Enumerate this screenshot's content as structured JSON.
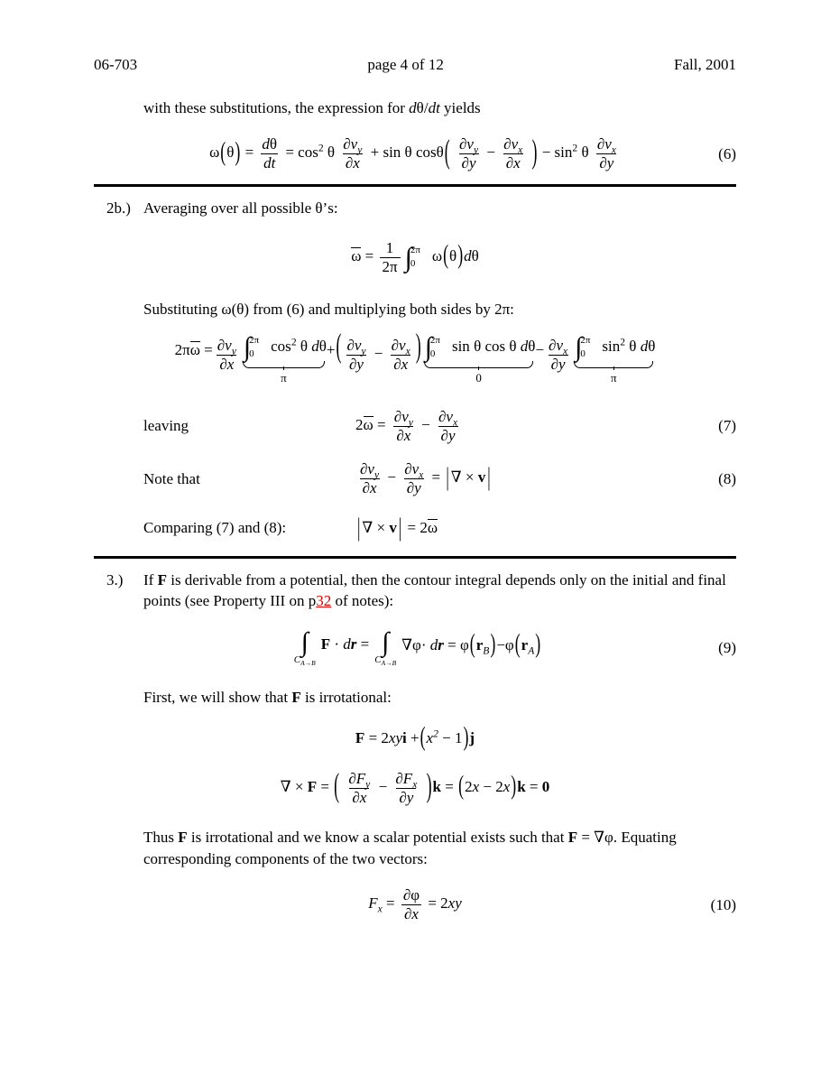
{
  "document": {
    "header": {
      "course_code": "06-703",
      "page_label": "page 4 of 12",
      "term": "Fall, 2001"
    },
    "intro_line": "with these substitutions, the expression for dθ/dt yields",
    "intro_parts": {
      "before": "with these substitutions, the expression for ",
      "math_d": "d",
      "math_theta": "θ",
      "math_slash": "/",
      "math_dt": "dt",
      "after": " yields"
    },
    "equations": {
      "eq6": {
        "number": "(6)",
        "omega": "ω",
        "theta": "θ",
        "lparen": "(",
        "rparen": ")",
        "equals": "=",
        "plus": "+",
        "minus": "−",
        "d_num": "d",
        "d_den": "dt",
        "cos": "cos",
        "sin": "sin",
        "exp2": "2",
        "partial": "∂",
        "v": "v",
        "sub_x": "x",
        "sub_y": "y"
      },
      "eq_avg": {
        "omega_bar": "ω",
        "equals": "=",
        "one": "1",
        "two_pi": "2π",
        "upper": "2π",
        "lower": "0",
        "integrand": "ω(θ)dθ"
      },
      "eq_big": {
        "lhs": "2πω",
        "equals": "=",
        "plus": "+",
        "minus": "−",
        "upper": "2π",
        "lower": "0",
        "term1_body": "cos² θ dθ",
        "term1_value": "π",
        "term2_body": "sin θ cos θ dθ",
        "term2_value": "0",
        "term3_body": "sin² θ dθ",
        "term3_value": "π"
      },
      "eq7": {
        "number": "(7)",
        "label": "leaving",
        "lhs": "2ω"
      },
      "eq8": {
        "number": "(8)",
        "label": "Note that",
        "rhs": "|∇ × v|"
      },
      "eq_compare": {
        "label": "Comparing (7) and (8):",
        "body": "|∇ × v| = 2ω"
      },
      "eq9": {
        "number": "(9)",
        "contour": "C",
        "contour_sub": "A→B",
        "F": "F",
        "dr": "dr",
        "nabla": "∇",
        "phi": "φ",
        "equals": "=",
        "minus": "−",
        "r": "r",
        "sub_B": "B",
        "sub_A": "A"
      },
      "eq_F": {
        "body": "F = 2xyi + (x² − 1)j"
      },
      "eq_curl": {
        "body": "∇ × F = (∂F_y/∂x − ∂F_x/∂y)k = (2x − 2x)k = 0"
      },
      "eq10": {
        "number": "(10)",
        "F": "F",
        "sub_x": "x",
        "equals": "=",
        "partial": "∂",
        "phi": "φ",
        "den": "∂x",
        "rhs": "2xy"
      }
    },
    "sections": [
      {
        "number": "2b.)",
        "text": "Averaging over all possible θ’s:"
      },
      {
        "number": "3.)",
        "text_part1": "If ",
        "bold_F": "F",
        "text_part2": " is derivable from a potential, then the contour integral depends only on the initial and final points (see Property III on p",
        "link_text": "32",
        "text_part3": " of notes):"
      }
    ],
    "paragraphs": {
      "substituting": "Substituting ω(θ) from (6) and multiplying both sides by 2π:",
      "first_show": "First, we will show that F is irrotational:",
      "first_show_a": "First, we will show that ",
      "first_show_b": "F",
      "first_show_c": " is irrotational:",
      "thus_a": "Thus ",
      "thus_b": "F",
      "thus_c": " is irrotational and we know a scalar potential exists such that ",
      "thus_d": "F",
      "thus_e": " = ∇φ. Equating corresponding components of the two vectors:"
    },
    "colors": {
      "text": "#000000",
      "link": "#e00000",
      "rule": "#000000",
      "background": "#ffffff"
    }
  }
}
